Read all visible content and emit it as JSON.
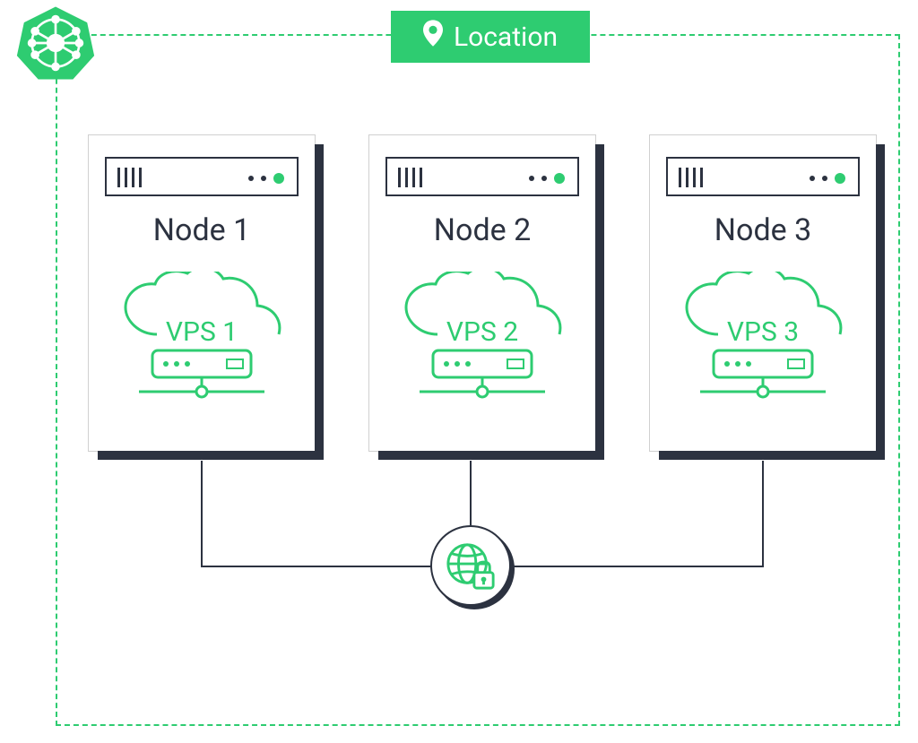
{
  "location": {
    "label": "Location"
  },
  "nodes": [
    {
      "label": "Node 1",
      "vps": "VPS 1"
    },
    {
      "label": "Node 2",
      "vps": "VPS 2"
    },
    {
      "label": "Node 3",
      "vps": "VPS 3"
    }
  ],
  "colors": {
    "accent": "#2ecc71",
    "dark": "#2c3240"
  }
}
